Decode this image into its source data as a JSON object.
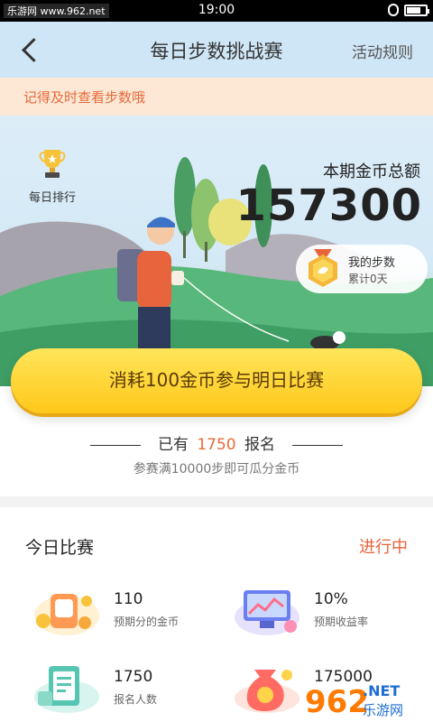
{
  "status": {
    "watermark": "乐游网 www.962.net",
    "time": "19:00"
  },
  "header": {
    "title": "每日步数挑战赛",
    "rules_label": "活动规则"
  },
  "reminder": "记得及时查看步数哦",
  "hero": {
    "rank_label": "每日排行",
    "pool_label": "本期金币总额",
    "pool_value": "157300",
    "my_steps_label": "我的步数",
    "my_steps_value": "累计0天"
  },
  "join_button": "消耗100金币参与明日比赛",
  "signup": {
    "prefix": "已有",
    "count": "1750",
    "suffix": "报名",
    "note": "参赛满10000步即可瓜分金币"
  },
  "today": {
    "title": "今日比赛",
    "status": "进行中",
    "stats": [
      {
        "value": "110",
        "label": "预期分的金币",
        "icon": "coin-bag-icon"
      },
      {
        "value": "10%",
        "label": "预期收益率",
        "icon": "chart-screen-icon"
      },
      {
        "value": "1750",
        "label": "报名人数",
        "icon": "clipboard-icon"
      },
      {
        "value": "175000",
        "label": "",
        "icon": "money-bag-icon"
      }
    ]
  },
  "corner_logo": {
    "mark": "962",
    "domain": ".NET",
    "name": "乐游网"
  },
  "colors": {
    "accent": "#e66b3a",
    "button": "#ffd234",
    "header_bg": "#cfe6f6"
  }
}
